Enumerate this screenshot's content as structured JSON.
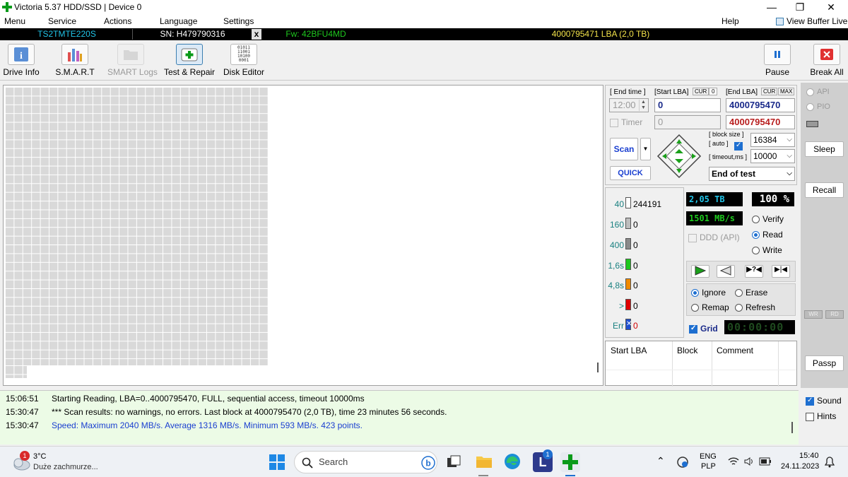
{
  "window": {
    "title": "Victoria 5.37 HDD/SSD | Device 0",
    "min_glyph": "—",
    "max_glyph": "❐",
    "close_glyph": "✕"
  },
  "menu": {
    "items": [
      "Menu",
      "Service",
      "Actions",
      "Language",
      "Settings"
    ],
    "help": "Help",
    "view_buffer": "View Buffer Live"
  },
  "infobar": {
    "model": "TS2TMTE220S",
    "serial": "SN: H479790316",
    "close": "x",
    "firmware": "Fw: 42BFU4MD",
    "capacity": "4000795471 LBA (2,0 TB)"
  },
  "toolbar": {
    "drive_info": "Drive Info",
    "smart": "S.M.A.R.T",
    "smart_logs": "SMART Logs",
    "test_repair": "Test & Repair",
    "disk_editor": "Disk Editor",
    "disk_editor_glyph": "01011\n11001\n10100\n0001",
    "pause": "Pause",
    "break_all": "Break All"
  },
  "scan_panel": {
    "end_time_label": "[ End time ]",
    "start_lba_label": "[Start LBA]",
    "cur_label": "CUR",
    "cur_value": "0",
    "end_lba_label": "[End LBA]",
    "max_label": "MAX",
    "end_time_value": "12:00",
    "start_lba_value": "0",
    "end_lba_value": "4000795470",
    "timer_label": "Timer",
    "timer_value": "0",
    "end_lba_value2": "4000795470",
    "scan_button": "Scan",
    "quick_button": "QUICK",
    "block_size_label": "[ block size ]",
    "auto_label": "[ auto ]",
    "block_size_value": "16384",
    "timeout_label": "[ timeout,ms ]",
    "timeout_value": "10000",
    "end_action": "End of test"
  },
  "stats": {
    "rows": [
      {
        "label": "40",
        "value": "244191",
        "color": "#ffffff"
      },
      {
        "label": "160",
        "value": "0",
        "color": "#bdbdbd"
      },
      {
        "label": "400",
        "value": "0",
        "color": "#8a8a8a"
      },
      {
        "label": "1,6s",
        "value": "0",
        "color": "#1ec81e"
      },
      {
        "label": "4,8s",
        "value": "0",
        "color": "#f08a00"
      },
      {
        "label": ">",
        "value": "0",
        "color": "#e00000"
      },
      {
        "label": "Err",
        "value": "0",
        "color": "#1e4fd0"
      }
    ],
    "err_glyph": "✕",
    "size_value": "2,05 TB",
    "percent_value": "100",
    "percent_sign": "%",
    "speed_value": "1501 MB/s",
    "ddd_label": "DDD (API)",
    "verify": "Verify",
    "read": "Read",
    "write": "Write",
    "ignore": "Ignore",
    "erase": "Erase",
    "remap": "Remap",
    "refresh": "Refresh",
    "grid_label": "Grid",
    "timer_display": "00:00:00"
  },
  "table": {
    "columns": [
      "Start LBA",
      "Block",
      "Comment"
    ]
  },
  "sidebar": {
    "api": "API",
    "pio": "PIO",
    "sleep": "Sleep",
    "recall": "Recall",
    "wr": "WR",
    "rd": "RD",
    "passp": "Passp",
    "sound": "Sound",
    "hints": "Hints"
  },
  "log": [
    {
      "time": "15:06:51",
      "text": "Starting Reading, LBA=0..4000795470, FULL, sequential access, timeout 10000ms",
      "color": "#000000"
    },
    {
      "time": "15:30:47",
      "text": "*** Scan results: no warnings, no errors. Last block at 4000795470 (2,0 TB), time 23 minutes 56 seconds.",
      "color": "#000000"
    },
    {
      "time": "15:30:47",
      "text": "Speed: Maximum 2040 MB/s. Average 1316 MB/s. Minimum 593 MB/s. 423 points.",
      "color": "#1a3fd0"
    }
  ],
  "taskbar": {
    "weather_temp": "3°C",
    "weather_desc": "Duże zachmurze...",
    "weather_badge": "1",
    "search": "Search",
    "app_badge": "1",
    "lang_top": "ENG",
    "lang_bottom": "PLP",
    "time": "15:40",
    "date": "24.11.2023"
  }
}
